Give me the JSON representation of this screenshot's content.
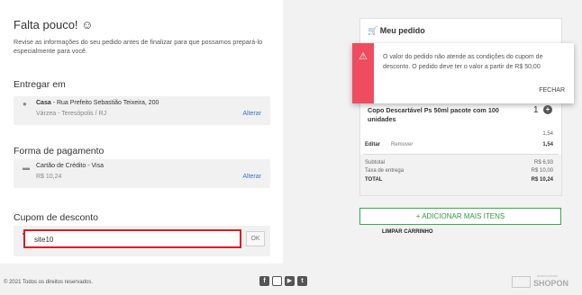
{
  "checkout": {
    "title": "Falta pouco! ☺",
    "lead": "Revise as informações do seu pedido antes de finalizar para que possamos prepará-lo especialmente para você.",
    "entregar_em": {
      "heading": "Entregar em",
      "name": "Casa",
      "street": " - Rua Prefeito Sebastião Teixeira, 200",
      "city": "Várzea - Teresópolis / RJ",
      "alterar": "Alterar"
    },
    "pagamento": {
      "heading": "Forma de pagamento",
      "method": "Cartão de Crédito - Visa",
      "amount": "R$ 10,24",
      "alterar": "Alterar"
    },
    "cupom": {
      "heading": "Cupom de desconto",
      "value": "site10",
      "ok": "OK"
    }
  },
  "pedido": {
    "title": "Meu pedido",
    "alert": {
      "message": "O valor do pedido não atende as condições do cupom de desconto. O pedido deve ter o valor a partir de R$ 50,00",
      "fechar": "FECHAR"
    },
    "item": {
      "name": "Copo Descartável Ps 50ml pacote com 100 unidades",
      "qty": "1",
      "unit_price": "1,54",
      "editar": "Editar",
      "remover": "Remover",
      "line_total": "1,54"
    },
    "totals": {
      "subtotal_label": "Subtotal",
      "subtotal": "R$ 6,93",
      "taxa_label": "Taxa de entrega",
      "taxa": "R$ 10,00",
      "total_label": "TOTAL",
      "total": "R$ 10,24"
    },
    "adicionar": "+ ADICIONAR MAIS ITENS",
    "limpar": "LIMPAR CARRINHO"
  },
  "footer": {
    "copyright": "© 2021 Todos os direitos reservados.",
    "social_icons": [
      "facebook-icon",
      "instagram-icon",
      "youtube-icon",
      "twitter-icon"
    ],
    "logo_small": "desenvolvido",
    "logo_text": "SHOPON"
  },
  "colors": {
    "accent_green": "#2f9a43",
    "alert_red": "#ef4c5f",
    "highlight_red": "#e11b1b",
    "link_blue": "#3a73c5"
  }
}
